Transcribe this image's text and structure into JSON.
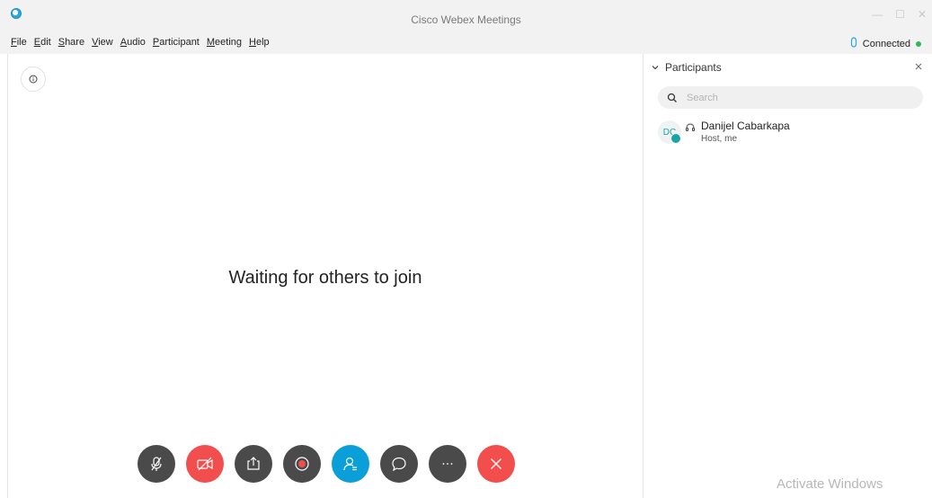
{
  "window": {
    "title": "Cisco Webex Meetings",
    "minimize": "—",
    "maximize": "☐",
    "close": "✕"
  },
  "menu": {
    "items": [
      "File",
      "Edit",
      "Share",
      "View",
      "Audio",
      "Participant",
      "Meeting",
      "Help"
    ]
  },
  "connection": {
    "label": "Connected",
    "color": "#2bbb56"
  },
  "main": {
    "waiting_text": "Waiting for others to join"
  },
  "controls": [
    {
      "name": "mute-button",
      "icon": "mic-muted-icon",
      "color": "#4a4a4a"
    },
    {
      "name": "video-button",
      "icon": "video-off-icon",
      "color": "#f24e4e"
    },
    {
      "name": "share-button",
      "icon": "share-icon",
      "color": "#4a4a4a"
    },
    {
      "name": "record-button",
      "icon": "record-icon",
      "color": "#4a4a4a"
    },
    {
      "name": "participants-button",
      "icon": "participants-icon",
      "color": "#0a9fd9"
    },
    {
      "name": "chat-button",
      "icon": "chat-icon",
      "color": "#4a4a4a"
    },
    {
      "name": "more-button",
      "icon": "more-icon",
      "color": "#4a4a4a"
    },
    {
      "name": "leave-button",
      "icon": "close-icon",
      "color": "#f24e4e"
    }
  ],
  "participants_panel": {
    "title": "Participants",
    "search_placeholder": "Search",
    "list": [
      {
        "initials": "DC",
        "name": "Danijel Cabarkapa",
        "role": "Host, me"
      }
    ]
  },
  "watermark": "Activate Windows"
}
